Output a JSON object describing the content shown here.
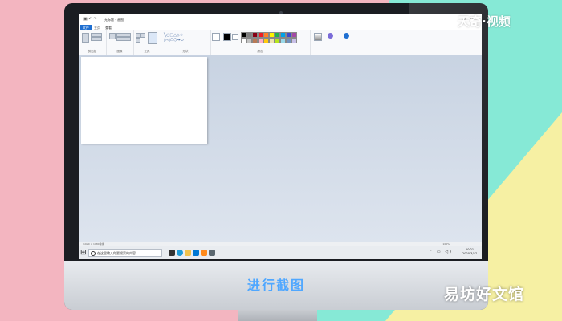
{
  "colors": {
    "pink": "#f3b5c0",
    "mint": "#86e9d6",
    "yellow": "#f6f0a3",
    "accent": "#4fa7ff"
  },
  "window": {
    "title": "无标题 - 画图"
  },
  "ribbon": {
    "tabs": [
      {
        "label": "文件"
      },
      {
        "label": "主页"
      },
      {
        "label": "查看"
      }
    ],
    "groups": [
      {
        "label": "剪贴板"
      },
      {
        "label": "图像"
      },
      {
        "label": "工具"
      },
      {
        "label": "形状"
      },
      {
        "label": "颜色"
      }
    ]
  },
  "palette": [
    "#000000",
    "#7f7f7f",
    "#880015",
    "#ed1c24",
    "#ff7f27",
    "#fff200",
    "#22b14c",
    "#00a2e8",
    "#3f48cc",
    "#a349a4",
    "#ffffff",
    "#c3c3c3",
    "#b97a57",
    "#ffaec9",
    "#ffc90e",
    "#efe4b0",
    "#b5e61d",
    "#99d9ea",
    "#7092be",
    "#c8bfe7"
  ],
  "status": {
    "left": "1920 × 1080像素",
    "zoom": "100%"
  },
  "taskbar": {
    "search_placeholder": "在这里输入你要搜索的内容",
    "time": "20:21",
    "date": "2020/3/27"
  },
  "chin": {
    "caption": "进行截图"
  },
  "watermark": {
    "top": "天奇·视频",
    "bottom": "易坊好文馆"
  }
}
